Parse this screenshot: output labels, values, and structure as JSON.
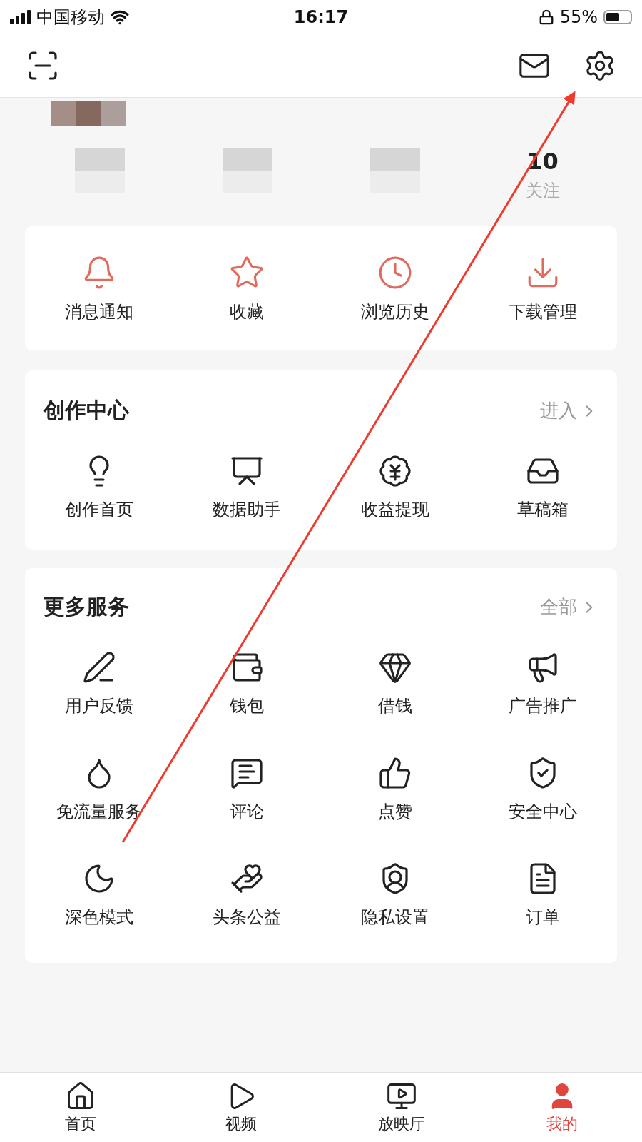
{
  "status_bar": {
    "carrier": "中国移动",
    "time": "16:17",
    "battery": "55%"
  },
  "stats": [
    {
      "kind": "blurred"
    },
    {
      "kind": "blurred"
    },
    {
      "kind": "blurred"
    },
    {
      "kind": "shown",
      "value": "10",
      "label": "关注"
    }
  ],
  "quick_actions": [
    "消息通知",
    "收藏",
    "浏览历史",
    "下载管理"
  ],
  "sections": [
    {
      "title": "创作中心",
      "link": "进入",
      "items": [
        "创作首页",
        "数据助手",
        "收益提现",
        "草稿箱"
      ]
    },
    {
      "title": "更多服务",
      "link": "全部",
      "items": [
        "用户反馈",
        "钱包",
        "借钱",
        "广告推广",
        "免流量服务",
        "评论",
        "点赞",
        "安全中心",
        "深色模式",
        "头条公益",
        "隐私设置",
        "订单"
      ]
    }
  ],
  "tabs": [
    {
      "label": "首页",
      "selected": false
    },
    {
      "label": "视频",
      "selected": false
    },
    {
      "label": "放映厅",
      "selected": false
    },
    {
      "label": "我的",
      "selected": true
    }
  ]
}
